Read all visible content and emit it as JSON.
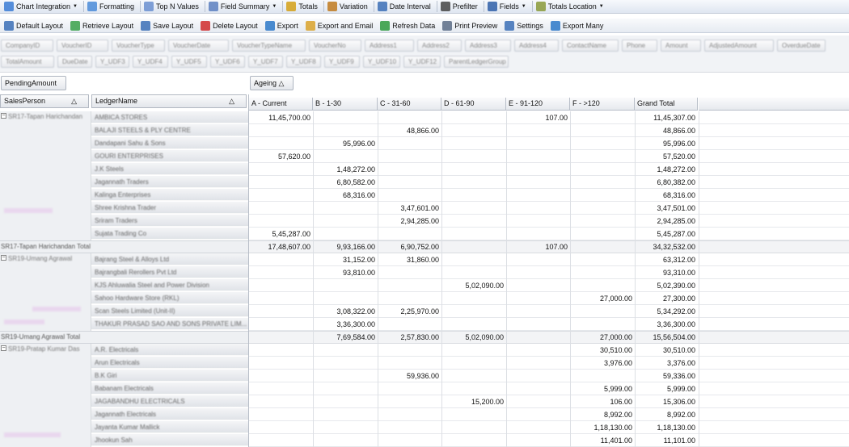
{
  "toolbar1": [
    {
      "label": "Chart Integration",
      "icon": "chart-icon",
      "dropdown": true,
      "color": "#3a7bd5"
    },
    {
      "label": "Formatting",
      "icon": "formatting-icon",
      "dropdown": false,
      "color": "#4a8bd8"
    },
    {
      "label": "Top N Values",
      "icon": "top-n-icon",
      "dropdown": false,
      "color": "#6a8fd0"
    },
    {
      "label": "Field Summary",
      "icon": "field-summary-icon",
      "dropdown": true,
      "color": "#5b7fc0"
    },
    {
      "label": "Totals",
      "icon": "totals-sigma-icon",
      "dropdown": false,
      "color": "#d4a017"
    },
    {
      "label": "Variation",
      "icon": "variation-icon",
      "dropdown": false,
      "color": "#c07a20"
    },
    {
      "label": "Date Interval",
      "icon": "date-interval-icon",
      "dropdown": false,
      "color": "#3b6fb6"
    },
    {
      "label": "Prefilter",
      "icon": "prefilter-icon",
      "dropdown": false,
      "color": "#444444"
    },
    {
      "label": "Fields",
      "icon": "fields-icon",
      "dropdown": true,
      "color": "#2f5fa8"
    },
    {
      "label": "Totals Location",
      "icon": "totals-location-icon",
      "dropdown": true,
      "color": "#8a9a3a"
    }
  ],
  "toolbar2": [
    {
      "label": "Default Layout",
      "icon": "default-layout-icon",
      "color": "#3b6fb6"
    },
    {
      "label": "Retrieve Layout",
      "icon": "retrieve-layout-icon",
      "color": "#3aa14a"
    },
    {
      "label": "Save Layout",
      "icon": "save-layout-icon",
      "color": "#3b6fb6"
    },
    {
      "label": "Delete Layout",
      "icon": "delete-layout-icon",
      "color": "#d02b2b"
    },
    {
      "label": "Export",
      "icon": "export-icon",
      "color": "#2c78c8"
    },
    {
      "label": "Export and Email",
      "icon": "export-email-icon",
      "color": "#d9a22a"
    },
    {
      "label": "Refresh Data",
      "icon": "refresh-data-icon",
      "color": "#2e9a3e"
    },
    {
      "label": "Print Preview",
      "icon": "print-preview-icon",
      "color": "#5a6c86"
    },
    {
      "label": "Settings",
      "icon": "settings-icon",
      "color": "#3b6fb6"
    },
    {
      "label": "Export Many",
      "icon": "export-many-icon",
      "color": "#2c78c8"
    }
  ],
  "hidden_fields_row1": [
    "CompanyID",
    "VoucherID",
    "VoucherType",
    "VoucherDate",
    "VoucherTypeName",
    "VoucherNo",
    "Address1",
    "Address2",
    "Address3",
    "Address4",
    "ContactName",
    "Phone",
    "Amount",
    "AdjustedAmount",
    "OverdueDate"
  ],
  "hidden_fields_row2": [
    "TotalAmount",
    "DueDate",
    "Y_UDF3",
    "Y_UDF4",
    "Y_UDF5",
    "Y_UDF6",
    "Y_UDF7",
    "Y_UDF8",
    "Y_UDF9",
    "Y_UDF10",
    "Y_UDF12",
    "ParentLedgerGroup"
  ],
  "data_area_field": "PendingAmount",
  "column_area_field": "Ageing",
  "row_fields": [
    "SalesPerson",
    "LedgerName"
  ],
  "columns": [
    "A - Current",
    "B - 1-30",
    "C - 31-60",
    "D - 61-90",
    "E - 91-120",
    "F - >120",
    "Grand Total"
  ],
  "rows": [
    {
      "sp": "SR17-Tapan Harichandan",
      "ledger": "AMBICA STORES",
      "v": [
        "11,45,700.00",
        "",
        "",
        "",
        "107.00",
        "",
        "11,45,307.00"
      ]
    },
    {
      "sp": "",
      "ledger": "BALAJI STEELS & PLY CENTRE",
      "v": [
        "",
        "",
        "48,866.00",
        "",
        "",
        "",
        "48,866.00"
      ]
    },
    {
      "sp": "",
      "ledger": "Dandapani Sahu & Sons",
      "v": [
        "",
        "95,996.00",
        "",
        "",
        "",
        "",
        "95,996.00"
      ]
    },
    {
      "sp": "",
      "ledger": "GOURI ENTERPRISES",
      "v": [
        "57,620.00",
        "",
        "",
        "",
        "",
        "",
        "57,520.00"
      ]
    },
    {
      "sp": "",
      "ledger": "J.K Steels",
      "v": [
        "",
        "1,48,272.00",
        "",
        "",
        "",
        "",
        "1,48,272.00"
      ]
    },
    {
      "sp": "",
      "ledger": "Jagannath Traders",
      "v": [
        "",
        "6,80,582.00",
        "",
        "",
        "",
        "",
        "6,80,382.00"
      ]
    },
    {
      "sp": "",
      "ledger": "Kalinga Enterprises",
      "v": [
        "",
        "68,316.00",
        "",
        "",
        "",
        "",
        "68,316.00"
      ]
    },
    {
      "sp": "",
      "ledger": "Shree Krishna Trader",
      "v": [
        "",
        "",
        "3,47,601.00",
        "",
        "",
        "",
        "3,47,501.00"
      ]
    },
    {
      "sp": "",
      "ledger": "Sriram Traders",
      "v": [
        "",
        "",
        "2,94,285.00",
        "",
        "",
        "",
        "2,94,285.00"
      ]
    },
    {
      "sp": "",
      "ledger": "Sujata Trading Co",
      "v": [
        "5,45,287.00",
        "",
        "",
        "",
        "",
        "",
        "5,45,287.00"
      ]
    },
    {
      "total": "SR17-Tapan Harichandan Total",
      "v": [
        "17,48,607.00",
        "9,93,166.00",
        "6,90,752.00",
        "",
        "107.00",
        "",
        "34,32,532.00"
      ]
    },
    {
      "sp": "SR19-Umang Agrawal",
      "ledger": "Bajrang Steel & Alloys Ltd",
      "v": [
        "",
        "31,152.00",
        "31,860.00",
        "",
        "",
        "",
        "63,312.00"
      ]
    },
    {
      "sp": "",
      "ledger": "Bajrangbali Rerollers Pvt Ltd",
      "v": [
        "",
        "93,810.00",
        "",
        "",
        "",
        "",
        "93,310.00"
      ]
    },
    {
      "sp": "",
      "ledger": "KJS Ahluwalia Steel and Power Division",
      "v": [
        "",
        "",
        "",
        "5,02,090.00",
        "",
        "",
        "5,02,390.00"
      ]
    },
    {
      "sp": "",
      "ledger": "Sahoo Hardware Store (RKL)",
      "v": [
        "",
        "",
        "",
        "",
        "",
        "27,000.00",
        "27,300.00"
      ]
    },
    {
      "sp": "",
      "ledger": "Scan Steels Limited (Unit-II)",
      "v": [
        "",
        "3,08,322.00",
        "2,25,970.00",
        "",
        "",
        "",
        "5,34,292.00"
      ]
    },
    {
      "sp": "",
      "ledger": "THAKUR PRASAD SAO AND SONS PRIVATE LIM...",
      "v": [
        "",
        "3,36,300.00",
        "",
        "",
        "",
        "",
        "3,36,300.00"
      ]
    },
    {
      "total": "SR19-Umang Agrawal Total",
      "v": [
        "",
        "7,69,584.00",
        "2,57,830.00",
        "5,02,090.00",
        "",
        "27,000.00",
        "15,56,504.00"
      ]
    },
    {
      "sp": "SR19-Pratap Kumar Das",
      "ledger": "A.R. Electricals",
      "v": [
        "",
        "",
        "",
        "",
        "",
        "30,510.00",
        "30,510.00"
      ]
    },
    {
      "sp": "",
      "ledger": "Arun Electricals",
      "v": [
        "",
        "",
        "",
        "",
        "",
        "3,976.00",
        "3,376.00"
      ]
    },
    {
      "sp": "",
      "ledger": "B.K Giri",
      "v": [
        "",
        "",
        "59,936.00",
        "",
        "",
        "",
        "59,336.00"
      ]
    },
    {
      "sp": "",
      "ledger": "Babanam Electricals",
      "v": [
        "",
        "",
        "",
        "",
        "",
        "5,999.00",
        "5,999.00"
      ]
    },
    {
      "sp": "",
      "ledger": "JAGABANDHU ELECTRICALS",
      "v": [
        "",
        "",
        "",
        "15,200.00",
        "",
        "106.00",
        "15,306.00"
      ]
    },
    {
      "sp": "",
      "ledger": "Jagannath Electricals",
      "v": [
        "",
        "",
        "",
        "",
        "",
        "8,992.00",
        "8,992.00"
      ]
    },
    {
      "sp": "",
      "ledger": "Jayanta Kumar Mallick",
      "v": [
        "",
        "",
        "",
        "",
        "",
        "1,18,130.00",
        "1,18,130.00"
      ]
    },
    {
      "sp": "",
      "ledger": "Jhookun Sah",
      "v": [
        "",
        "",
        "",
        "",
        "",
        "11,401.00",
        "11,101.00"
      ]
    }
  ]
}
